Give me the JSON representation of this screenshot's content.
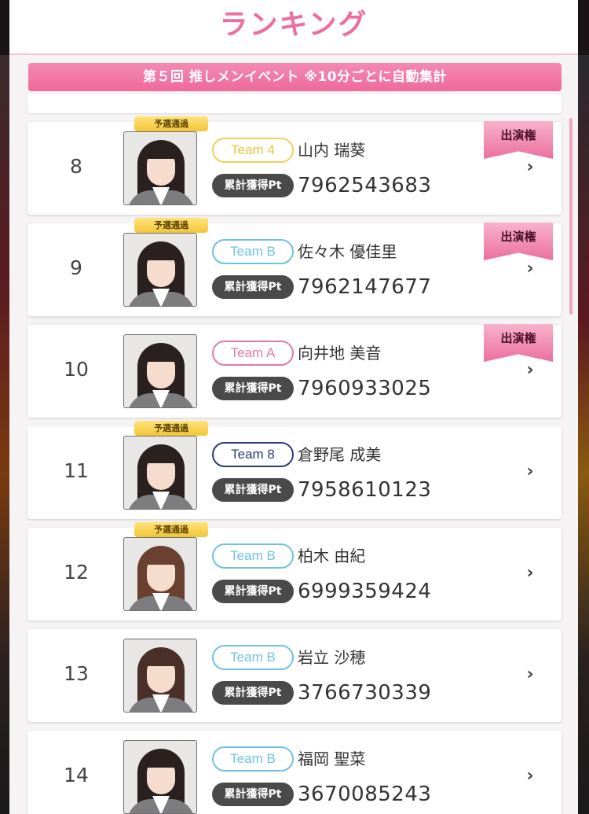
{
  "header": {
    "title": "ランキング"
  },
  "banner": {
    "text": "第５回 推しメンイベント ※10分ごとに自動集計"
  },
  "labels": {
    "qualified": "予選通過",
    "points_label": "累計獲得Pt",
    "award": "出演権",
    "chevron": "›"
  },
  "rows": [
    {
      "rank": "8",
      "team": "Team 4",
      "team_color": "#e9c43d",
      "name": "山内 瑞葵",
      "points": "7962543683",
      "qualified": true,
      "award": true
    },
    {
      "rank": "9",
      "team": "Team B",
      "team_color": "#6fc2e3",
      "name": "佐々木 優佳里",
      "points": "7962147677",
      "qualified": true,
      "award": true
    },
    {
      "rank": "10",
      "team": "Team A",
      "team_color": "#e57aa7",
      "name": "向井地 美音",
      "points": "7960933025",
      "qualified": false,
      "award": true
    },
    {
      "rank": "11",
      "team": "Team 8",
      "team_color": "#2b3a78",
      "name": "倉野尾 成美",
      "points": "7958610123",
      "qualified": true,
      "award": false
    },
    {
      "rank": "12",
      "team": "Team B",
      "team_color": "#6fc2e3",
      "name": "柏木 由紀",
      "points": "6999359424",
      "qualified": true,
      "award": false
    },
    {
      "rank": "13",
      "team": "Team B",
      "team_color": "#6fc2e3",
      "name": "岩立 沙穂",
      "points": "3766730339",
      "qualified": false,
      "award": false
    },
    {
      "rank": "14",
      "team": "Team B",
      "team_color": "#6fc2e3",
      "name": "福岡 聖菜",
      "points": "3670085243",
      "qualified": false,
      "award": false
    }
  ],
  "colors": {
    "accent": "#ec6f9f",
    "banner": "#ee6a9b",
    "qualified_badge": "#f2c53a"
  }
}
